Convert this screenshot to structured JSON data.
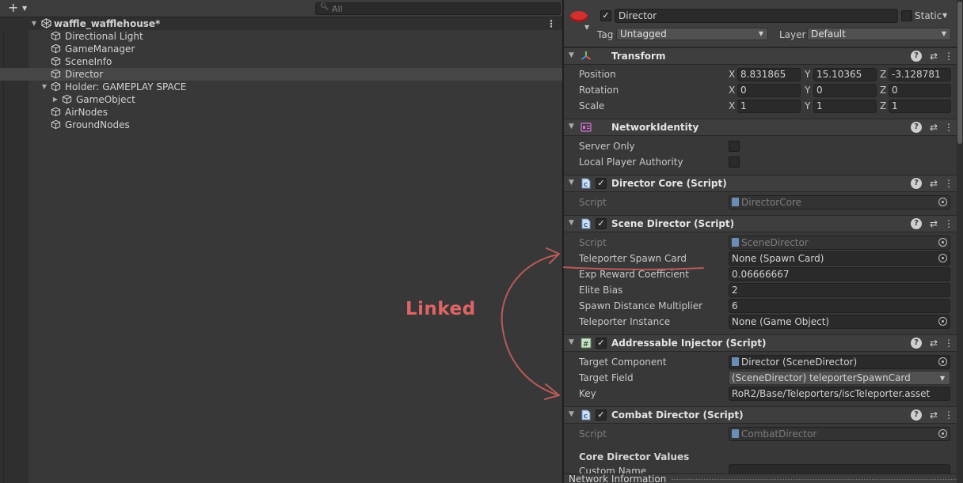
{
  "hierarchy": {
    "search_placeholder": "All",
    "scene_name": "waffle_wafflehouse*",
    "items": [
      {
        "label": "Directional Light"
      },
      {
        "label": "GameManager"
      },
      {
        "label": "SceneInfo"
      },
      {
        "label": "Director"
      },
      {
        "label": "Holder: GAMEPLAY SPACE"
      },
      {
        "label": "GameObject"
      },
      {
        "label": "AirNodes"
      },
      {
        "label": "GroundNodes"
      }
    ]
  },
  "inspector": {
    "object_name": "Director",
    "static_label": "Static",
    "tag_label": "Tag",
    "tag_value": "Untagged",
    "layer_label": "Layer",
    "layer_value": "Default",
    "transform": {
      "title": "Transform",
      "position_label": "Position",
      "rotation_label": "Rotation",
      "scale_label": "Scale",
      "axis_x": "X",
      "axis_y": "Y",
      "axis_z": "Z",
      "position": [
        "8.831865",
        "15.10365",
        "-3.128781"
      ],
      "rotation": [
        "0",
        "0",
        "0"
      ],
      "scale": [
        "1",
        "1",
        "1"
      ]
    },
    "network_identity": {
      "title": "NetworkIdentity",
      "server_only_label": "Server Only",
      "local_player_label": "Local Player Authority"
    },
    "director_core": {
      "title": "Director Core (Script)",
      "script_label": "Script",
      "script_value": "DirectorCore"
    },
    "scene_director": {
      "title": "Scene Director (Script)",
      "script_label": "Script",
      "script_value": "SceneDirector",
      "spawn_card_label": "Teleporter Spawn Card",
      "spawn_card_value": "None (Spawn Card)",
      "exp_label": "Exp Reward Coefficient",
      "exp_value": "0.06666667",
      "elite_label": "Elite Bias",
      "elite_value": "2",
      "spawn_dist_label": "Spawn Distance Multiplier",
      "spawn_dist_value": "6",
      "tele_instance_label": "Teleporter Instance",
      "tele_instance_value": "None (Game Object)"
    },
    "addressable_injector": {
      "title": "Addressable Injector (Script)",
      "target_component_label": "Target Component",
      "target_component_value": "Director (SceneDirector)",
      "target_field_label": "Target Field",
      "target_field_value": "(SceneDirector) teleporterSpawnCard",
      "key_label": "Key",
      "key_value": "RoR2/Base/Teleporters/iscTeleporter.asset"
    },
    "combat_director": {
      "title": "Combat Director (Script)",
      "script_label": "Script",
      "script_value": "CombatDirector",
      "section_label": "Core Director Values",
      "custom_name_label": "Custom Name"
    },
    "bottom_label": "Network Information"
  },
  "annotation": {
    "text": "Linked",
    "color": "#e06464"
  },
  "colors": {
    "panel_bg": "#383838",
    "header_bg": "#3e3e3e",
    "field_bg": "#2a2a2a",
    "selected_row": "#464646"
  }
}
